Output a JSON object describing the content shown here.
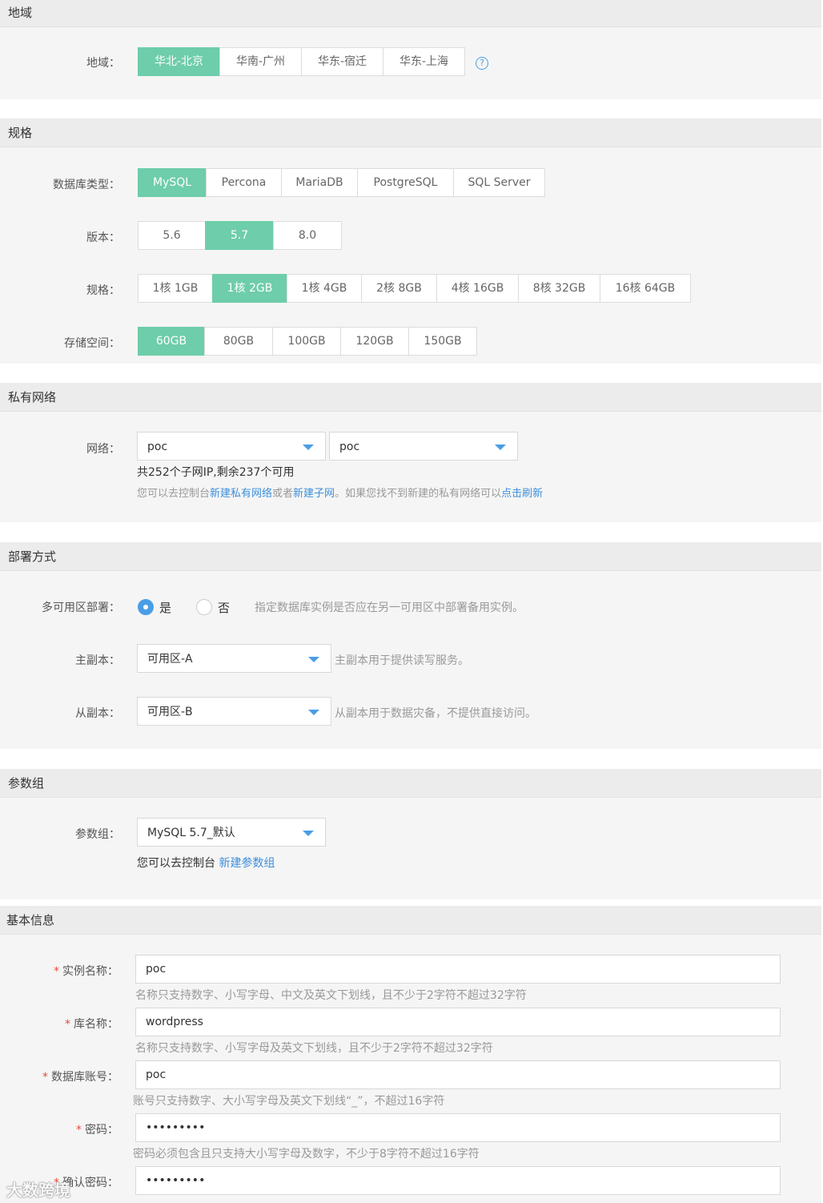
{
  "region": {
    "section_title": "地域",
    "label": "地域：",
    "options": [
      "华北-北京",
      "华南-广州",
      "华东-宿迁",
      "华东-上海"
    ],
    "selected": 0,
    "help_icon": "question-circle-icon"
  },
  "spec": {
    "section_title": "规格",
    "db_type_label": "数据库类型：",
    "db_types": [
      "MySQL",
      "Percona",
      "MariaDB",
      "PostgreSQL",
      "SQL Server"
    ],
    "version_label": "版本：",
    "versions": [
      "5.6",
      "5.7",
      "8.0"
    ],
    "spec_label": "规格：",
    "specs": [
      "1核 1GB",
      "1核 2GB",
      "1核 4GB",
      "2核 8GB",
      "4核 16GB",
      "8核 32GB",
      "16核 64GB"
    ],
    "storage_label": "存储空间：",
    "storages": [
      "60GB",
      "80GB",
      "100GB",
      "120GB",
      "150GB"
    ]
  },
  "vpc": {
    "section_title": "私有网络",
    "label": "网络：",
    "vpc_value": "poc",
    "subnet_value": "poc",
    "ip_info": "共252个子网IP,剩余237个可用",
    "hint_1": "您可以去控制台",
    "link_new_vpc": "新建私有网络",
    "hint_2": "或者",
    "link_new_subnet": "新建子网",
    "hint_3": "。如果您找不到新建的私有网络可以",
    "link_refresh": "点击刷新"
  },
  "deploy": {
    "section_title": "部署方式",
    "multi_az_label": "多可用区部署：",
    "yes_label": "是",
    "no_label": "否",
    "multi_az_hint": "指定数据库实例是否应在另一可用区中部署备用实例。",
    "primary_label": "主副本：",
    "primary_value": "可用区-A",
    "primary_hint": "主副本用于提供读写服务。",
    "secondary_label": "从副本：",
    "secondary_value": "可用区-B",
    "secondary_hint": "从副本用于数据灾备，不提供直接访问。"
  },
  "params": {
    "section_title": "参数组",
    "label": "参数组：",
    "value": "MySQL 5.7_默认",
    "hint": "您可以去控制台",
    "link_new": "新建参数组"
  },
  "basic": {
    "section_title": "基本信息",
    "required_mark": "*",
    "instance_label": "实例名称：",
    "instance_value": "poc",
    "instance_hint": "名称只支持数字、小写字母、中文及英文下划线，且不少于2字符不超过32字符",
    "dbname_label": "库名称：",
    "dbname_value": "wordpress",
    "dbname_hint": "名称只支持数字、小写字母及英文下划线，且不少于2字符不超过32字符",
    "account_label": "数据库账号：",
    "account_value": "poc",
    "account_hint": "账号只支持数字、大小写字母及英文下划线“_”，不超过16字符",
    "password_label": "密码：",
    "password_value": "•••••••••",
    "password_hint": "密码必须包含且只支持大小写字母及数字，不少于8字符不超过16字符",
    "confirm_label": "确认密码：",
    "confirm_value": "•••••••••"
  },
  "watermark": "大数跨境",
  "colors": {
    "selected": "#6ecdaa",
    "link": "#3d8fdc",
    "accent": "#4a9ee5",
    "required": "#e74c3c"
  }
}
